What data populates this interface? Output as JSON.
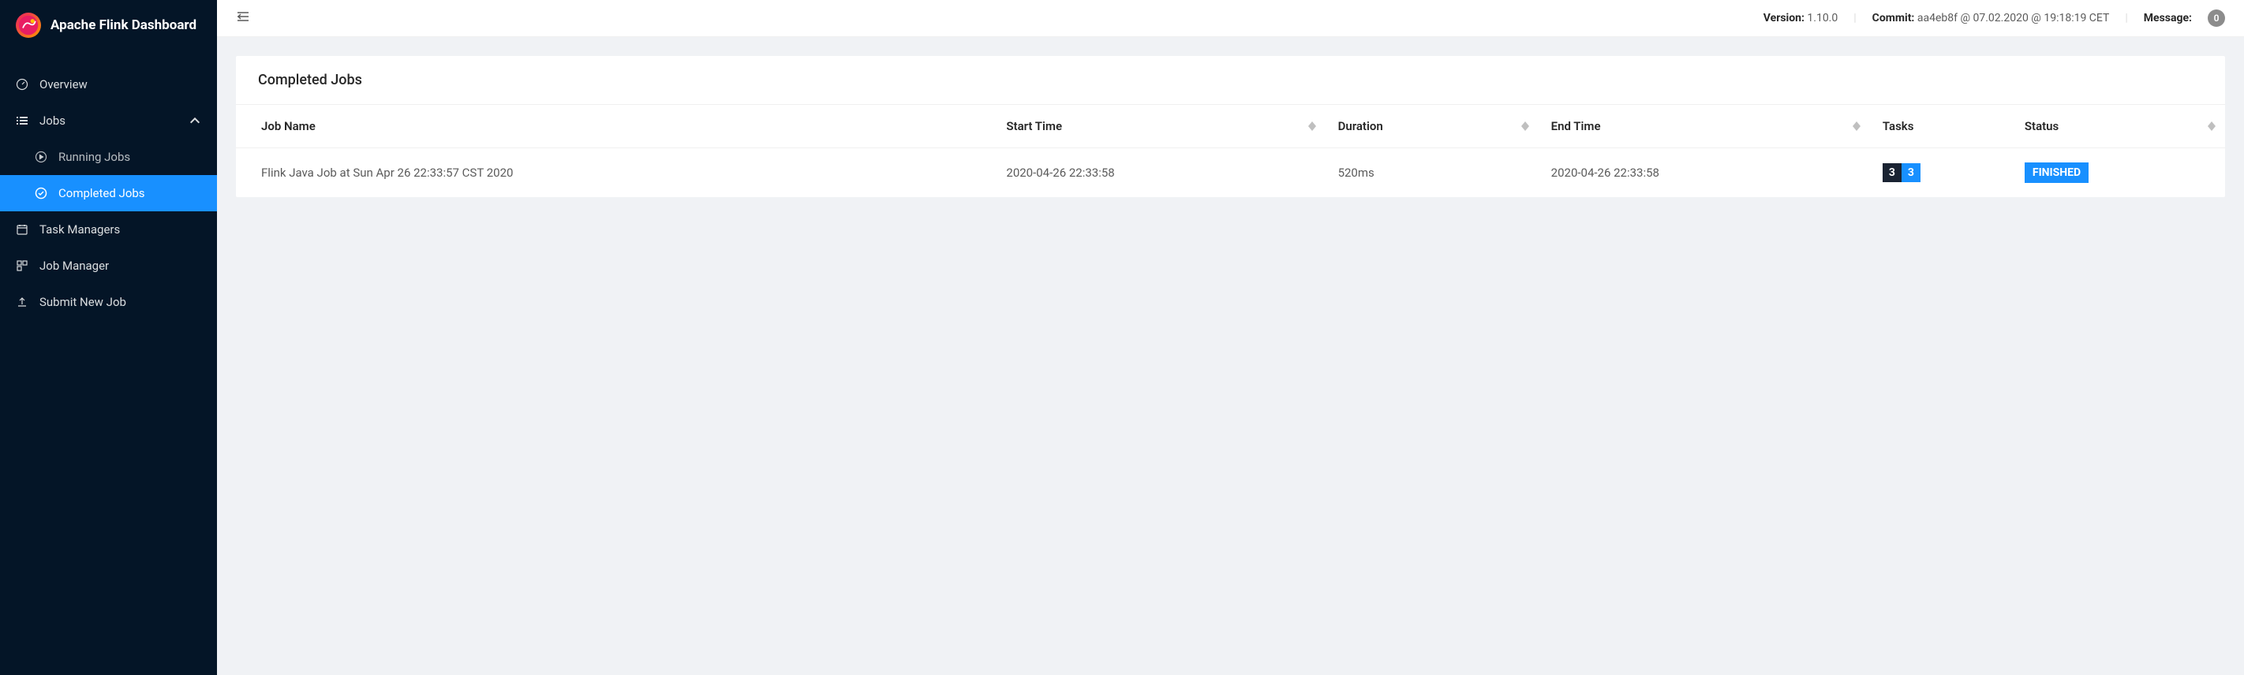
{
  "brand": "Apache Flink Dashboard",
  "header": {
    "version_label": "Version:",
    "version_value": "1.10.0",
    "commit_label": "Commit:",
    "commit_value": "aa4eb8f @ 07.02.2020 @ 19:18:19 CET",
    "message_label": "Message:",
    "message_count": "0"
  },
  "nav": {
    "overview": "Overview",
    "jobs": "Jobs",
    "running_jobs": "Running Jobs",
    "completed_jobs": "Completed Jobs",
    "task_managers": "Task Managers",
    "job_manager": "Job Manager",
    "submit_new_job": "Submit New Job"
  },
  "page": {
    "title": "Completed Jobs"
  },
  "table": {
    "columns": {
      "job_name": "Job Name",
      "start_time": "Start Time",
      "duration": "Duration",
      "end_time": "End Time",
      "tasks": "Tasks",
      "status": "Status"
    },
    "rows": [
      {
        "job_name": "Flink Java Job at Sun Apr 26 22:33:57 CST 2020",
        "start_time": "2020-04-26 22:33:58",
        "duration": "520ms",
        "end_time": "2020-04-26 22:33:58",
        "tasks_total": "3",
        "tasks_done": "3",
        "status": "FINISHED"
      }
    ]
  }
}
